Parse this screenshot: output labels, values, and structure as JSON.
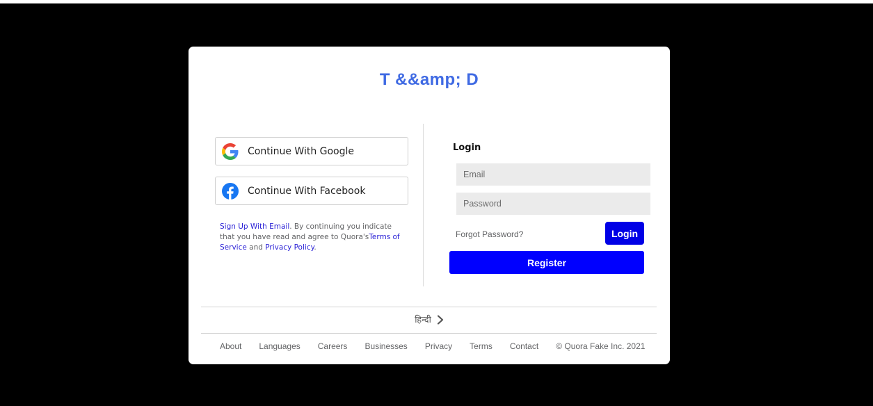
{
  "brand": {
    "title": "T &&amp; D"
  },
  "social": {
    "google_label": "Continue With Google",
    "facebook_label": "Continue With Facebook",
    "google_icon": "google-g-icon",
    "facebook_icon": "facebook-f-icon"
  },
  "signup": {
    "link": "Sign Up With Email",
    "text_1": ". By continuing you indicate that you have read and agree to Quora's",
    "terms_link": "Terms of Service",
    "text_2": " and ",
    "privacy_link": "Privacy Policy",
    "text_3": "."
  },
  "login": {
    "title": "Login",
    "email_placeholder": "Email",
    "password_placeholder": "Password",
    "forgot_label": "Forgot Password?",
    "login_button": "Login",
    "register_button": "Register"
  },
  "language": {
    "label": "हिन्दी",
    "icon": "chevron-right-icon"
  },
  "footer": {
    "links": [
      "About",
      "Languages",
      "Careers",
      "Businesses",
      "Privacy",
      "Terms",
      "Contact"
    ],
    "copyright": "© Quora Fake Inc. 2021"
  },
  "colors": {
    "brand": "#3f6ae3",
    "primary_button": "#0000ff",
    "link": "#2b22d6",
    "background": "#000000",
    "card": "#ffffff",
    "input_bg": "#ebebeb"
  }
}
